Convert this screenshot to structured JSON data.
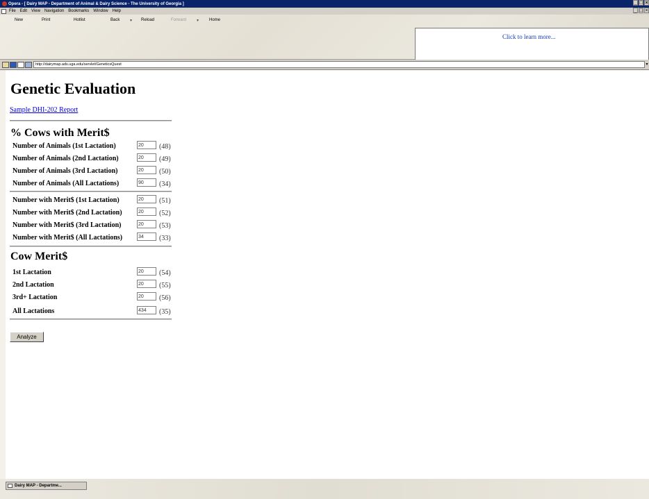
{
  "window": {
    "title": "Opera - [ Dairy MAP - Department of Animal & Dairy Science - The University of Georgia ]",
    "controls": [
      "_",
      "□",
      "×"
    ]
  },
  "menu": [
    "File",
    "Edit",
    "View",
    "Navigation",
    "Bookmarks",
    "Window",
    "Help"
  ],
  "toolbar": {
    "new": "New",
    "print": "Print",
    "hotlist": "Hotlist",
    "back": "Back",
    "reload": "Reload",
    "forward": "Forward",
    "home": "Home",
    "ad_text": "Click to learn more..."
  },
  "address": {
    "url": "http://dairymap.ads.uga.edu/servlet/GeneticsQuest"
  },
  "page": {
    "title": "Genetic Evaluation",
    "report_link": "Sample DHI-202 Report",
    "section1": {
      "heading": "% Cows with Merit$",
      "group_a": [
        {
          "label": "Number of Animals (1st Lactation)",
          "value": "20",
          "code": "(48)"
        },
        {
          "label": "Number of Animals (2nd Lactation)",
          "value": "20",
          "code": "(49)"
        },
        {
          "label": "Number of Animals (3rd Lactation)",
          "value": "20",
          "code": "(50)"
        },
        {
          "label": "Number of Animals (All Lactations)",
          "value": "90",
          "code": "(34)"
        }
      ],
      "group_b": [
        {
          "label": "Number with Merit$ (1st Lactation)",
          "value": "20",
          "code": "(51)"
        },
        {
          "label": "Number with Merit$ (2nd Lactation)",
          "value": "20",
          "code": "(52)"
        },
        {
          "label": "Number with Merit$ (3rd Lactation)",
          "value": "20",
          "code": "(53)"
        },
        {
          "label": "Number with Merit$ (All Lactations)",
          "value": "34",
          "code": "(33)"
        }
      ]
    },
    "section2": {
      "heading": "Cow Merit$",
      "rows": [
        {
          "label": "1st Lactation",
          "value": "20",
          "code": "(54)"
        },
        {
          "label": "2nd Lactation",
          "value": "20",
          "code": "(55)"
        },
        {
          "label": "3rd+ Lactation",
          "value": "20",
          "code": "(56)"
        },
        {
          "label": "All Lactations",
          "value": "434",
          "code": "(35)"
        }
      ]
    },
    "analyze_label": "Analyze"
  },
  "taskbar": {
    "item": "Dairy MAP - Departme..."
  }
}
